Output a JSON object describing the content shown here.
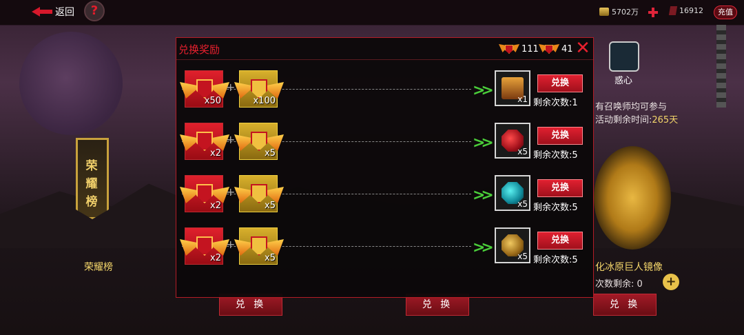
{
  "topbar": {
    "back_label": "返回",
    "help_glyph": "?",
    "gold": "5702万",
    "gems": "16912",
    "recharge_label": "充值"
  },
  "background": {
    "banner_text": "荣耀榜",
    "left_card_label": "荣耀榜",
    "heart_label": "惑心",
    "right_text": "有召唤师均可参与",
    "right_time_prefix": "活动剩余时间:",
    "right_time_value": "265天",
    "right_card_label": "化冰原巨人镜像",
    "right_count_label": "次数剩余:",
    "right_count_value": "0",
    "bottom_buttons": [
      "兑 换",
      "兑 换",
      "兑 换"
    ]
  },
  "modal": {
    "title": "兑换奖励",
    "currency_red": "111",
    "currency_gold": "41",
    "close_glyph": "✕",
    "rows": [
      {
        "cost_red": "x50",
        "cost_gold": "x100",
        "reward_qty": "x1",
        "reward_icon": "title-badge-icon",
        "button": "兑换",
        "remain_label": "剩余次数:",
        "remain_value": "1"
      },
      {
        "cost_red": "x2",
        "cost_gold": "x5",
        "reward_qty": "x5",
        "reward_icon": "red-gem-icon",
        "button": "兑换",
        "remain_label": "剩余次数:",
        "remain_value": "5"
      },
      {
        "cost_red": "x2",
        "cost_gold": "x5",
        "reward_qty": "x5",
        "reward_icon": "cyan-gem-icon",
        "button": "兑换",
        "remain_label": "剩余次数:",
        "remain_value": "5"
      },
      {
        "cost_red": "x2",
        "cost_gold": "x5",
        "reward_qty": "x5",
        "reward_icon": "gold-gem-icon",
        "button": "兑换",
        "remain_label": "剩余次数:",
        "remain_value": "5"
      }
    ]
  },
  "colors": {
    "accent_red": "#e8202e",
    "arrow_green": "#4acd3a",
    "gold_text": "#f3d56a"
  }
}
